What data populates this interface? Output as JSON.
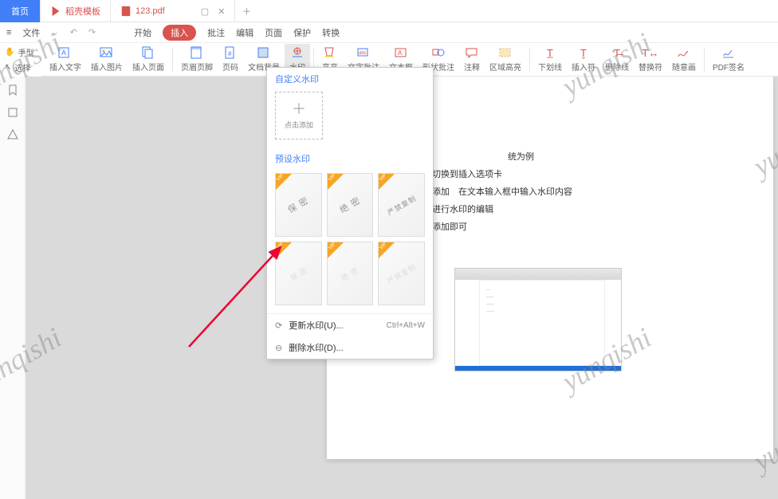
{
  "tabs": {
    "home": "首页",
    "template": "稻壳模板",
    "file": "123.pdf"
  },
  "menu": {
    "file": "文件",
    "start": "开始",
    "insert": "插入",
    "annotate": "批注",
    "edit": "编辑",
    "page": "页面",
    "protect": "保护",
    "convert": "转换"
  },
  "leftcol": {
    "hand": "手型",
    "select": "选择"
  },
  "tools": {
    "text": "插入文字",
    "image": "插入图片",
    "pages": "插入页面",
    "header": "页眉页脚",
    "pagenum": "页码",
    "bg": "文档背景",
    "watermark": "水印",
    "highlight": "高亮",
    "textannot": "文字批注",
    "textbox": "文本框",
    "shape": "形状批注",
    "note": "注释",
    "area": "区域高亮",
    "under": "下划线",
    "insertch": "插入符",
    "strike": "删除线",
    "replace": "替换符",
    "freehand": "随意画",
    "sign": "PDF签名"
  },
  "dd": {
    "custom": "自定义水印",
    "add": "点击添加",
    "preset": "预设水印",
    "p1": "保 密",
    "p2": "绝 密",
    "p3": "严禁复制",
    "update": "更新水印(U)...",
    "delete": "删除水印(D)...",
    "sc": "Ctrl+Alt+W",
    "vip": "VIP"
  },
  "doc": {
    "title": "统为例",
    "l1": "件　切换到插入选项卡",
    "l2": "点击添加　在文本输入框中输入水印内容",
    "l3": "页面进行水印的编辑",
    "l4": "确认添加即可"
  },
  "wm": "yunqishi"
}
